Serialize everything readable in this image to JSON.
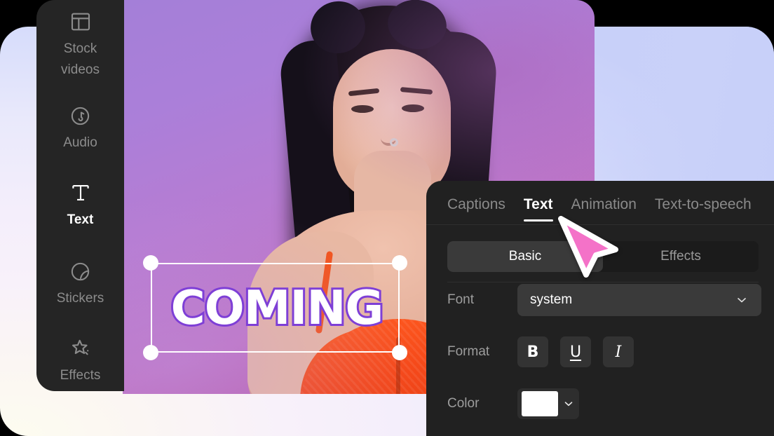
{
  "app": {
    "background_left_color": "#f8f1fa",
    "background_right_color": "#c9d1f9",
    "panel_bg_color": "#212121",
    "sidebar_bg_color": "#252525",
    "accent_cursor_color": "#f472c8"
  },
  "sidebar": {
    "items": [
      {
        "label": "Stock\nvideos",
        "line1": "Stock",
        "line2": "videos",
        "icon": "layout-grid-icon",
        "active": false
      },
      {
        "label": "Audio",
        "line1": "Audio",
        "line2": "",
        "icon": "audio-note-icon",
        "active": false
      },
      {
        "label": "Text",
        "line1": "Text",
        "line2": "",
        "icon": "text-t-icon",
        "active": true
      },
      {
        "label": "Stickers",
        "line1": "Stickers",
        "line2": "",
        "icon": "sticker-circle-icon",
        "active": false
      },
      {
        "label": "Effects",
        "line1": "Effects",
        "line2": "",
        "icon": "sparkle-star-icon",
        "active": false
      }
    ]
  },
  "canvas": {
    "text_element": {
      "value": "COMING",
      "fill_color": "#ffffff",
      "outline_color": "#7e3fd6",
      "selected": true,
      "handles": 4
    }
  },
  "panel": {
    "tabs": [
      {
        "label": "Captions",
        "active": false
      },
      {
        "label": "Text",
        "active": true
      },
      {
        "label": "Animation",
        "active": false
      },
      {
        "label": "Text-to-speech",
        "active": false
      }
    ],
    "segmented": [
      {
        "label": "Basic",
        "active": true
      },
      {
        "label": "Effects",
        "active": false
      }
    ],
    "rows": {
      "font": {
        "label": "Font",
        "value": "system",
        "chevron": "chevron-down-icon"
      },
      "format": {
        "label": "Format",
        "buttons": [
          {
            "glyph": "B",
            "name": "bold"
          },
          {
            "glyph": "U",
            "name": "underline"
          },
          {
            "glyph": "I",
            "name": "italic"
          }
        ]
      },
      "color": {
        "label": "Color",
        "value": "#ffffff",
        "chevron": "chevron-down-icon"
      }
    }
  }
}
